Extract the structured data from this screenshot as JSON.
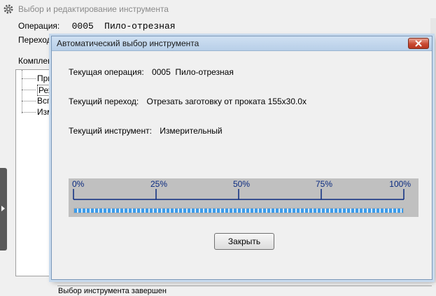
{
  "parent_window": {
    "title": "Выбор и редактирование инструмента",
    "operation_label": "Операция:",
    "operation_code": "0005",
    "operation_name": "Пило-отрезная",
    "transition_label": "Переход",
    "kit_label": "Комплек",
    "tree_items": [
      "При",
      "Реж",
      "Вспо",
      "Изм"
    ]
  },
  "dialog": {
    "title": "Автоматический выбор инструмента",
    "current_operation_label": "Текущая операция:",
    "current_operation_value": "0005  Пило-отрезная",
    "current_transition_label": "Текущий переход:",
    "current_transition_value": "Отрезать заготовку от проката 155x30.0x",
    "current_tool_label": "Текущий инструмент:",
    "current_tool_value": "Измерительный",
    "progress": {
      "tick_labels": [
        "0%",
        "25%",
        "50%",
        "75%",
        "100%"
      ],
      "value_percent": 100
    },
    "close_button": "Закрыть",
    "status": "Выбор инструмента завершен"
  },
  "colors": {
    "ruler": "#0a2a80",
    "progress_fill": "#3c9bea",
    "close_icon_bg": "#c94a32"
  },
  "icons": {
    "window": "gear-icon",
    "dialog_close": "close-icon"
  }
}
